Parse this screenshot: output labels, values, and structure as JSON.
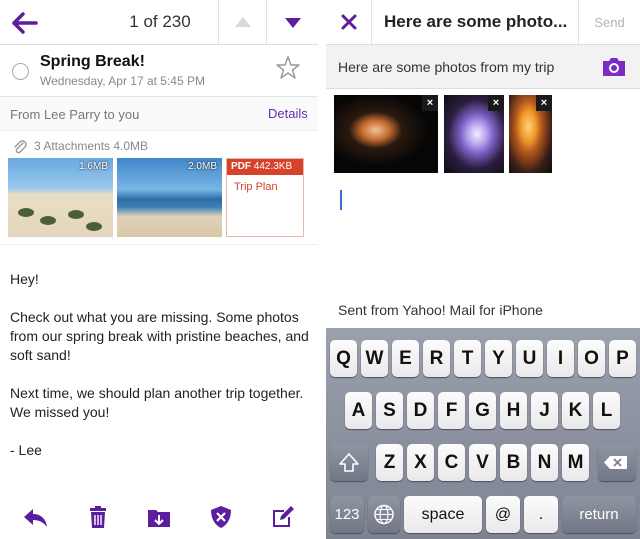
{
  "left_view": {
    "counter": "1 of 230",
    "subject": "Spring Break!",
    "date": "Wednesday, Apr 17 at 5:45 PM",
    "from_line": "From Lee Parry to you",
    "details_label": "Details",
    "attachments": {
      "summary": "3 Attachments  4.0MB",
      "items": [
        {
          "size": "1.6MB",
          "kind": "beach photo"
        },
        {
          "size": "2.0MB",
          "kind": "ocean photo"
        },
        {
          "type_label": "PDF",
          "size": "442.3KB",
          "name": "Trip Plan"
        }
      ]
    },
    "body": [
      "Hey!",
      "Check out what you are missing. Some photos from our spring break with pristine beaches, and soft sand!",
      "Next time, we should plan another trip together. We missed you!",
      "- Lee"
    ],
    "toolbar_icons": [
      "reply-icon",
      "trash-icon",
      "move-folder-icon",
      "spam-shield-icon",
      "compose-icon"
    ],
    "accent_color": "#5c1e9e"
  },
  "right_view": {
    "title": "Here are some photo...",
    "send_label": "Send",
    "subject": "Here are some photos from my trip",
    "photos": [
      {
        "remove": "×"
      },
      {
        "remove": "×"
      },
      {
        "remove": "×"
      }
    ],
    "signature": "Sent from Yahoo! Mail for iPhone",
    "keyboard": {
      "row1": [
        "Q",
        "W",
        "E",
        "R",
        "T",
        "Y",
        "U",
        "I",
        "O",
        "P"
      ],
      "row2": [
        "A",
        "S",
        "D",
        "F",
        "G",
        "H",
        "J",
        "K",
        "L"
      ],
      "row3": [
        "Z",
        "X",
        "C",
        "V",
        "B",
        "N",
        "M"
      ],
      "shift_icon": "shift-icon",
      "delete_icon": "backspace-icon",
      "numbers_label": "123",
      "globe_icon": "globe-icon",
      "space_label": "space",
      "at_label": "@",
      "dot_label": ".",
      "return_label": "return"
    }
  }
}
